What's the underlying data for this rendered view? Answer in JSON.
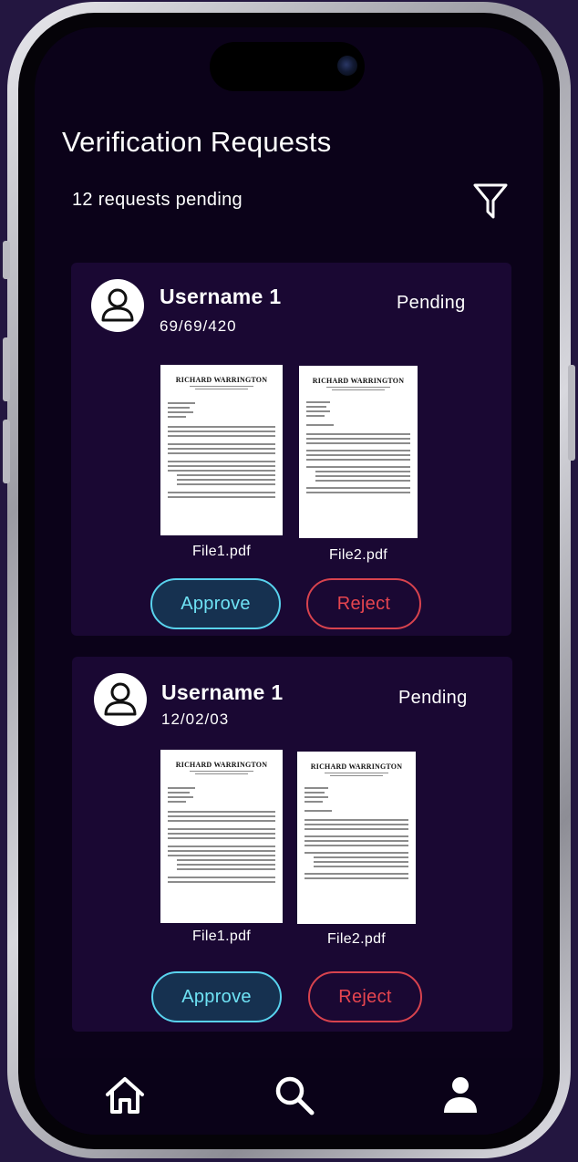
{
  "header": {
    "title": "Verification Requests",
    "pending_count": "12 requests pending"
  },
  "requests": [
    {
      "username": "Username 1",
      "date": "69/69/420",
      "status": "Pending",
      "files": [
        {
          "name": "File1.pdf",
          "doc_title": "RICHARD WARRINGTON"
        },
        {
          "name": "File2.pdf",
          "doc_title": "RICHARD WARRINGTON"
        }
      ],
      "approve_label": "Approve",
      "reject_label": "Reject"
    },
    {
      "username": "Username 1",
      "date": "12/02/03",
      "status": "Pending",
      "files": [
        {
          "name": "File1.pdf",
          "doc_title": "RICHARD WARRINGTON"
        },
        {
          "name": "File2.pdf",
          "doc_title": "RICHARD WARRINGTON"
        }
      ],
      "approve_label": "Approve",
      "reject_label": "Reject"
    }
  ],
  "nav": {
    "items": [
      {
        "icon": "home-icon"
      },
      {
        "icon": "search-icon"
      },
      {
        "icon": "profile-icon"
      }
    ]
  },
  "colors": {
    "background": "#0b0219",
    "card": "#1a0833",
    "approve": "#59d3ee",
    "reject": "#d8434e"
  }
}
